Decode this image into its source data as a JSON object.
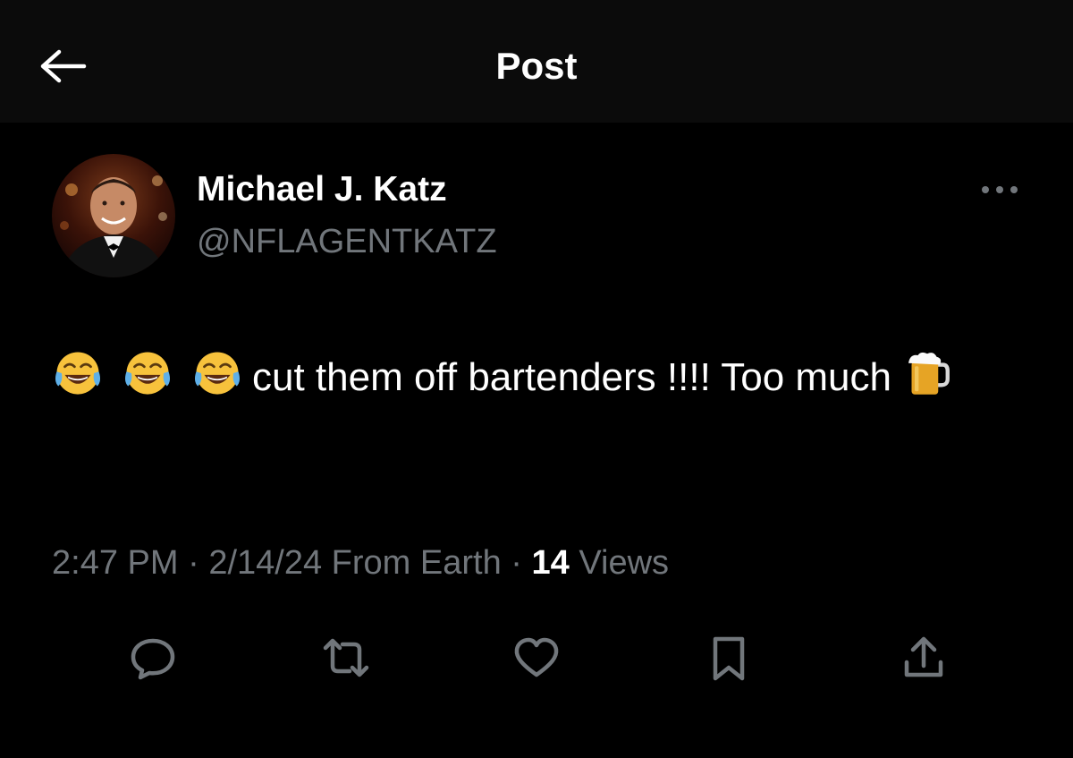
{
  "header": {
    "title": "Post",
    "back_icon": "arrow-left-icon"
  },
  "author": {
    "display_name": "Michael J. Katz",
    "handle": "@NFLAGENTKATZ",
    "avatar": "profile-photo"
  },
  "post": {
    "text_main": "cut them off bartenders !!!! Too much",
    "emojis_leading": [
      "face-with-tears-of-joy",
      "face-with-tears-of-joy",
      "face-with-tears-of-joy"
    ],
    "emoji_trailing": "beer-mug"
  },
  "meta": {
    "time": "2:47 PM",
    "sep1": " · ",
    "date": "2/14/24",
    "location": " From Earth",
    "sep2": " · ",
    "views_count": "14",
    "views_label": " Views"
  },
  "actions": [
    {
      "name": "reply",
      "icon": "speech-bubble-icon"
    },
    {
      "name": "repost",
      "icon": "repost-arrows-icon"
    },
    {
      "name": "like",
      "icon": "heart-icon"
    },
    {
      "name": "bookmark",
      "icon": "bookmark-icon"
    },
    {
      "name": "share",
      "icon": "share-upload-icon"
    }
  ],
  "colors": {
    "background": "#000000",
    "header_background": "#0b0b0b",
    "primary_text": "#ffffff",
    "secondary_text": "#71767b"
  }
}
